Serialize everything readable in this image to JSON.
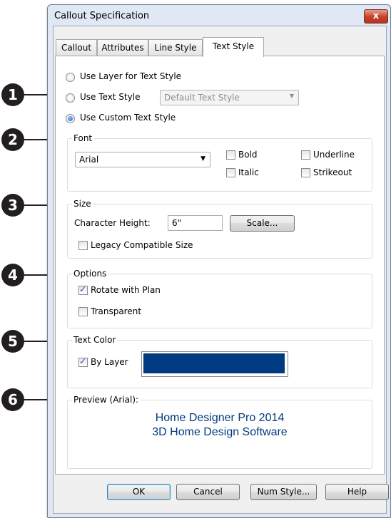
{
  "window": {
    "title": "Callout Specification",
    "close_glyph": "x"
  },
  "tabs": [
    {
      "label": "Callout",
      "active": false
    },
    {
      "label": "Attributes",
      "active": false
    },
    {
      "label": "Line Style",
      "active": false
    },
    {
      "label": "Text Style",
      "active": true
    }
  ],
  "text_style_source": {
    "options": [
      {
        "label": "Use Layer for Text Style",
        "selected": false
      },
      {
        "label": "Use Text Style",
        "selected": false
      },
      {
        "label": "Use Custom Text Style",
        "selected": true
      }
    ],
    "text_style_select": {
      "value": "Default Text Style",
      "enabled": false
    }
  },
  "font": {
    "legend": "Font",
    "font_select": {
      "value": "Arial"
    },
    "bold": {
      "label": "Bold",
      "checked": false
    },
    "italic": {
      "label": "Italic",
      "checked": false
    },
    "underline": {
      "label": "Underline",
      "checked": false
    },
    "strikeout": {
      "label": "Strikeout",
      "checked": false
    }
  },
  "size": {
    "legend": "Size",
    "character_height_label": "Character Height:",
    "character_height_value": "6\"",
    "scale_button": "Scale...",
    "legacy": {
      "label": "Legacy Compatible Size",
      "checked": false
    }
  },
  "options": {
    "legend": "Options",
    "rotate": {
      "label": "Rotate with Plan",
      "checked": true
    },
    "transparent": {
      "label": "Transparent",
      "checked": false
    }
  },
  "text_color": {
    "legend": "Text Color",
    "by_layer": {
      "label": "By Layer",
      "checked": true
    },
    "swatch_color": "#003a80"
  },
  "preview": {
    "legend": "Preview (Arial):",
    "line1": "Home Designer Pro 2014",
    "line2": "3D Home Design Software",
    "text_color": "#003a80"
  },
  "buttons": {
    "ok": "OK",
    "cancel": "Cancel",
    "num_style": "Num Style...",
    "help": "Help"
  },
  "callouts": [
    "1",
    "2",
    "3",
    "4",
    "5",
    "6"
  ]
}
